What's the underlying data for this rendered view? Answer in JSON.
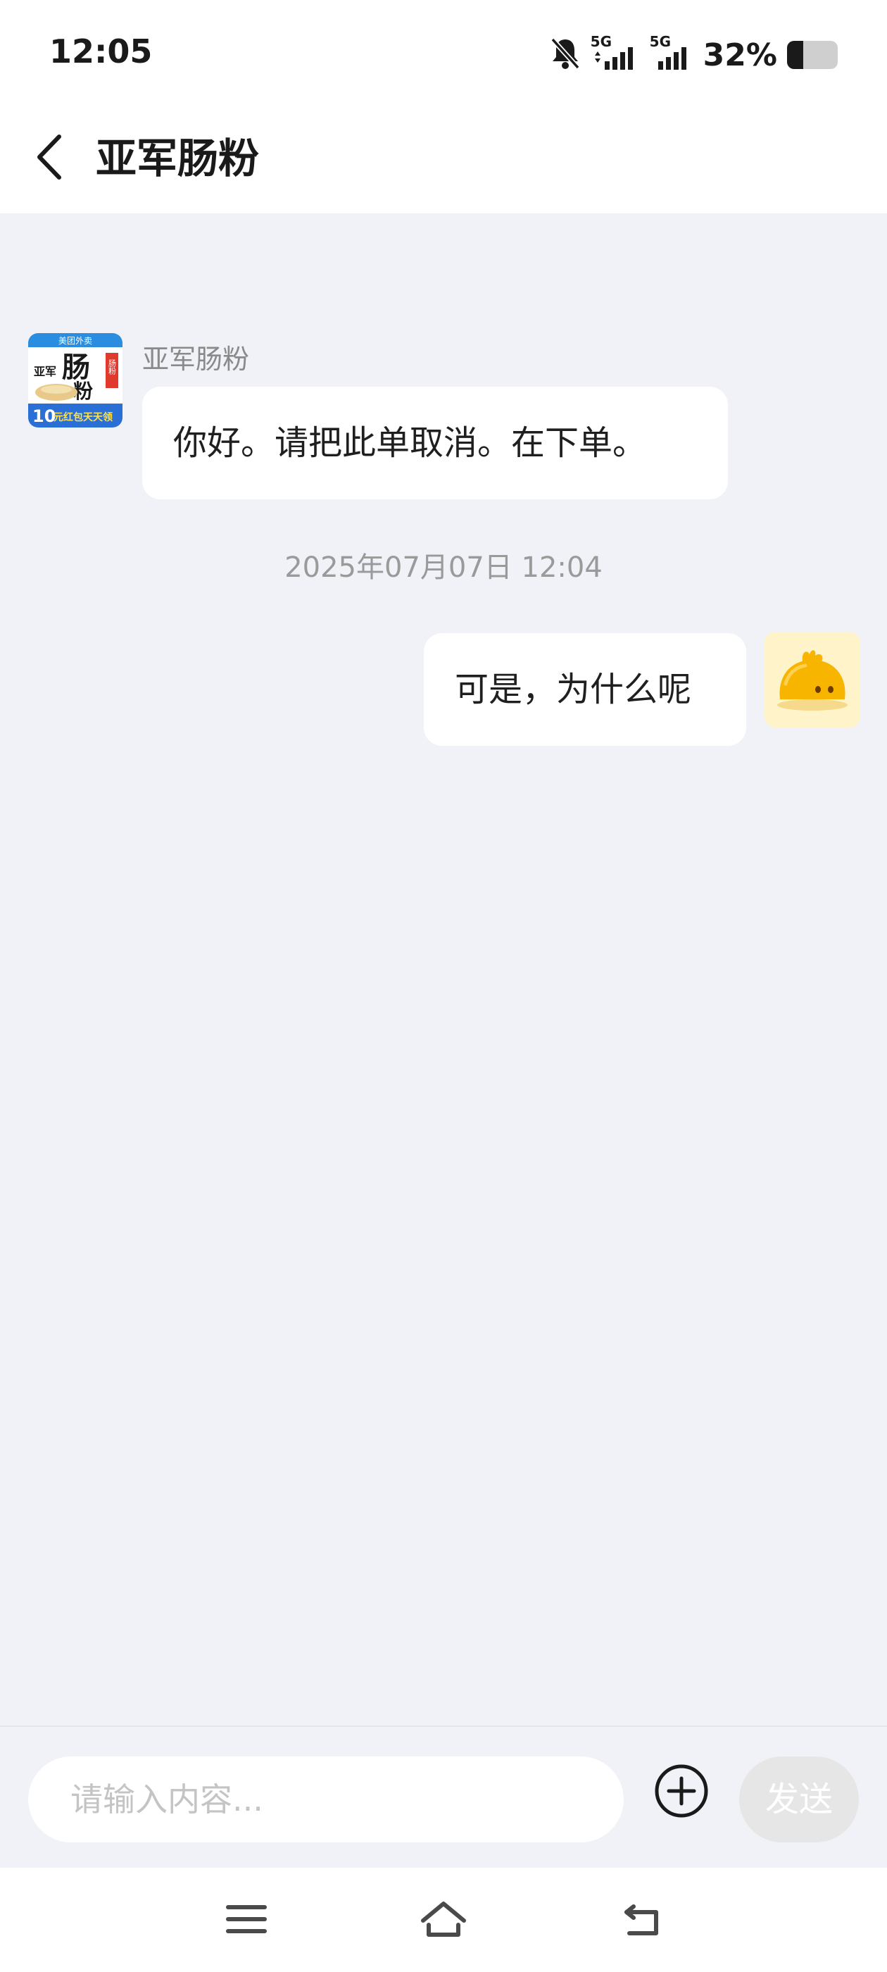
{
  "status_bar": {
    "time": "12:05",
    "network_1": "5G",
    "network_2": "5G",
    "battery_percent": "32%",
    "icons": [
      "bell-mute-icon",
      "signal-icon",
      "signal-icon",
      "battery-icon"
    ]
  },
  "header": {
    "title": "亚军肠粉",
    "back_icon": "chevron-left-icon"
  },
  "chat": {
    "messages": [
      {
        "direction": "incoming",
        "sender": "亚军肠粉",
        "text": "你好。请把此单取消。在下单。"
      },
      {
        "direction": "timestamp",
        "text": "2025年07月07日 12:04"
      },
      {
        "direction": "outgoing",
        "text": "可是，为什么呢"
      }
    ],
    "merchant_logo": {
      "top_text": "美团外卖",
      "brand_chars": "亚军",
      "big_char_1": "肠",
      "big_char_2": "粉",
      "red_badge": "肠粉",
      "bottom_number": "10",
      "bottom_text": "元红包天天领"
    }
  },
  "input_bar": {
    "placeholder": "请输入内容...",
    "send_label": "发送",
    "plus_icon": "plus-circle-icon"
  },
  "nav_bar": {
    "icons": [
      "menu-icon",
      "home-icon",
      "back-icon"
    ]
  },
  "colors": {
    "background": "#f0f2f7",
    "bubble": "#ffffff",
    "send_disabled": "#e6e6e6",
    "avatar_bg": "#fff4c9",
    "avatar_yellow": "#f7b500"
  }
}
